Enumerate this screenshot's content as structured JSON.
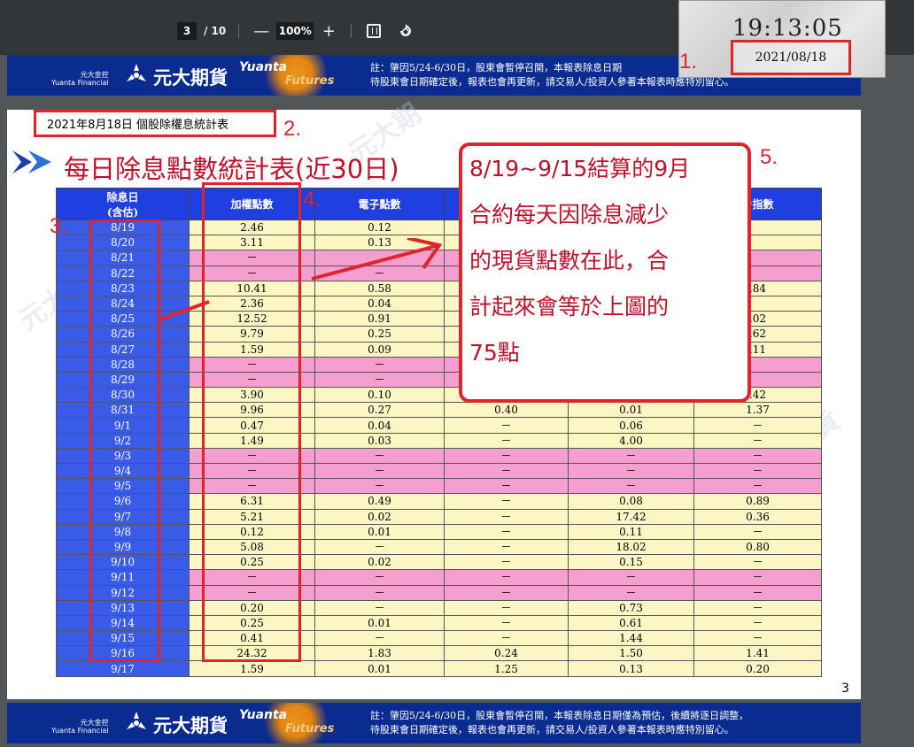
{
  "toolbar": {
    "current_page": "3",
    "total_pages": "/ 10",
    "zoom": "100%",
    "zoom_out": "—",
    "zoom_in": "+"
  },
  "clock": {
    "time": "19:13:05",
    "date": "2021/08/18"
  },
  "annotations": {
    "a1": "1.",
    "a2": "2.",
    "a3": "3.",
    "a4": "4.",
    "a5": "5."
  },
  "banner": {
    "small_zh": "元大金控",
    "small_en": "Yuanta Financial",
    "name": "元大期貨",
    "yuanta": "Yuanta",
    "futures": "Futures",
    "note_top_line1": "註：肇因5/24-6/30日，股東會暫停召開，本報表除息日期",
    "note_top_line2": "待股東會日期確定後，報表也會再更新，請交易人/投資人參著本報表時應特別留心。",
    "note_bottom_line1": "註：肇因5/24-6/30日，股東會暫停召開，本報表除息日期僅為預估，後續將逐日調整，",
    "note_bottom_line2": "待股東會日期確定後，報表也會再更新，請交易人/投資人參著本報表時應特別留心。"
  },
  "page": {
    "subtitle": "2021年8月18日 個股除權息統計表",
    "title": "每日除息點數統計表(近30日)",
    "page_number": "3",
    "callout": [
      "8/19~9/15結算的9月",
      "合約每天因除息減少",
      "的現貨點數在此，合",
      "計起來會等於上圖的",
      "75點"
    ]
  },
  "table": {
    "headers": [
      "除息日\n(含估)",
      "加權點數",
      "電子點數",
      "",
      "",
      "台指數"
    ],
    "rows": [
      {
        "date": "8/19",
        "type": "y",
        "cells": [
          "2.46",
          "0.12",
          "",
          "",
          ""
        ]
      },
      {
        "date": "8/20",
        "type": "y",
        "cells": [
          "3.11",
          "0.13",
          "",
          "",
          ""
        ]
      },
      {
        "date": "8/21",
        "type": "p",
        "cells": [
          "－",
          "",
          "",
          "",
          ""
        ]
      },
      {
        "date": "8/22",
        "type": "p",
        "cells": [
          "－",
          "－",
          "",
          "",
          ""
        ]
      },
      {
        "date": "8/23",
        "type": "y",
        "cells": [
          "10.41",
          "0.58",
          "",
          "",
          ".84"
        ]
      },
      {
        "date": "8/24",
        "type": "y",
        "cells": [
          "2.36",
          "0.04",
          "",
          "",
          ""
        ]
      },
      {
        "date": "8/25",
        "type": "y",
        "cells": [
          "12.52",
          "0.91",
          "",
          "",
          ".02"
        ]
      },
      {
        "date": "8/26",
        "type": "y",
        "cells": [
          "9.79",
          "0.25",
          "",
          "",
          ".62"
        ]
      },
      {
        "date": "8/27",
        "type": "y",
        "cells": [
          "1.59",
          "0.09",
          "",
          "",
          ".11"
        ]
      },
      {
        "date": "8/28",
        "type": "p",
        "cells": [
          "－",
          "－",
          "",
          "",
          ""
        ]
      },
      {
        "date": "8/29",
        "type": "p",
        "cells": [
          "－",
          "－",
          "",
          "",
          ""
        ]
      },
      {
        "date": "8/30",
        "type": "y",
        "cells": [
          "3.90",
          "0.10",
          "",
          "",
          ".42"
        ]
      },
      {
        "date": "8/31",
        "type": "y",
        "cells": [
          "9.96",
          "0.27",
          "0.40",
          "0.01",
          "1.37"
        ]
      },
      {
        "date": "9/1",
        "type": "y",
        "cells": [
          "0.47",
          "0.04",
          "－",
          "0.06",
          "－"
        ]
      },
      {
        "date": "9/2",
        "type": "y",
        "cells": [
          "1.49",
          "0.03",
          "－",
          "4.00",
          "－"
        ]
      },
      {
        "date": "9/3",
        "type": "p",
        "cells": [
          "－",
          "－",
          "－",
          "－",
          "－"
        ]
      },
      {
        "date": "9/4",
        "type": "p",
        "cells": [
          "－",
          "－",
          "－",
          "－",
          "－"
        ]
      },
      {
        "date": "9/5",
        "type": "p",
        "cells": [
          "－",
          "－",
          "－",
          "－",
          "－"
        ]
      },
      {
        "date": "9/6",
        "type": "y",
        "cells": [
          "6.31",
          "0.49",
          "－",
          "0.08",
          "0.89"
        ]
      },
      {
        "date": "9/7",
        "type": "y",
        "cells": [
          "5.21",
          "0.02",
          "－",
          "17.42",
          "0.36"
        ]
      },
      {
        "date": "9/8",
        "type": "y",
        "cells": [
          "0.12",
          "0.01",
          "－",
          "0.11",
          "－"
        ]
      },
      {
        "date": "9/9",
        "type": "y",
        "cells": [
          "5.08",
          "－",
          "－",
          "18.02",
          "0.80"
        ]
      },
      {
        "date": "9/10",
        "type": "y",
        "cells": [
          "0.25",
          "0.02",
          "－",
          "0.15",
          "－"
        ]
      },
      {
        "date": "9/11",
        "type": "p",
        "cells": [
          "－",
          "－",
          "－",
          "－",
          "－"
        ]
      },
      {
        "date": "9/12",
        "type": "p",
        "cells": [
          "－",
          "－",
          "－",
          "－",
          "－"
        ]
      },
      {
        "date": "9/13",
        "type": "y",
        "cells": [
          "0.20",
          "－",
          "－",
          "0.73",
          "－"
        ]
      },
      {
        "date": "9/14",
        "type": "y",
        "cells": [
          "0.25",
          "0.01",
          "－",
          "0.61",
          "－"
        ]
      },
      {
        "date": "9/15",
        "type": "y",
        "cells": [
          "0.41",
          "－",
          "－",
          "1.44",
          "－"
        ]
      },
      {
        "date": "9/16",
        "type": "y",
        "cells": [
          "24.32",
          "1.83",
          "0.24",
          "1.50",
          "1.41"
        ]
      },
      {
        "date": "9/17",
        "type": "y",
        "cells": [
          "1.59",
          "0.01",
          "1.25",
          "0.13",
          "0.20"
        ]
      }
    ]
  },
  "colors": {
    "annotation_red": "#e0242c",
    "title_red": "#c0102a",
    "banner_blue": "#0a2b8f",
    "header_blue": "#1f3fe0",
    "row_yellow": "#fbf6c4",
    "row_pink": "#f49fd0"
  }
}
